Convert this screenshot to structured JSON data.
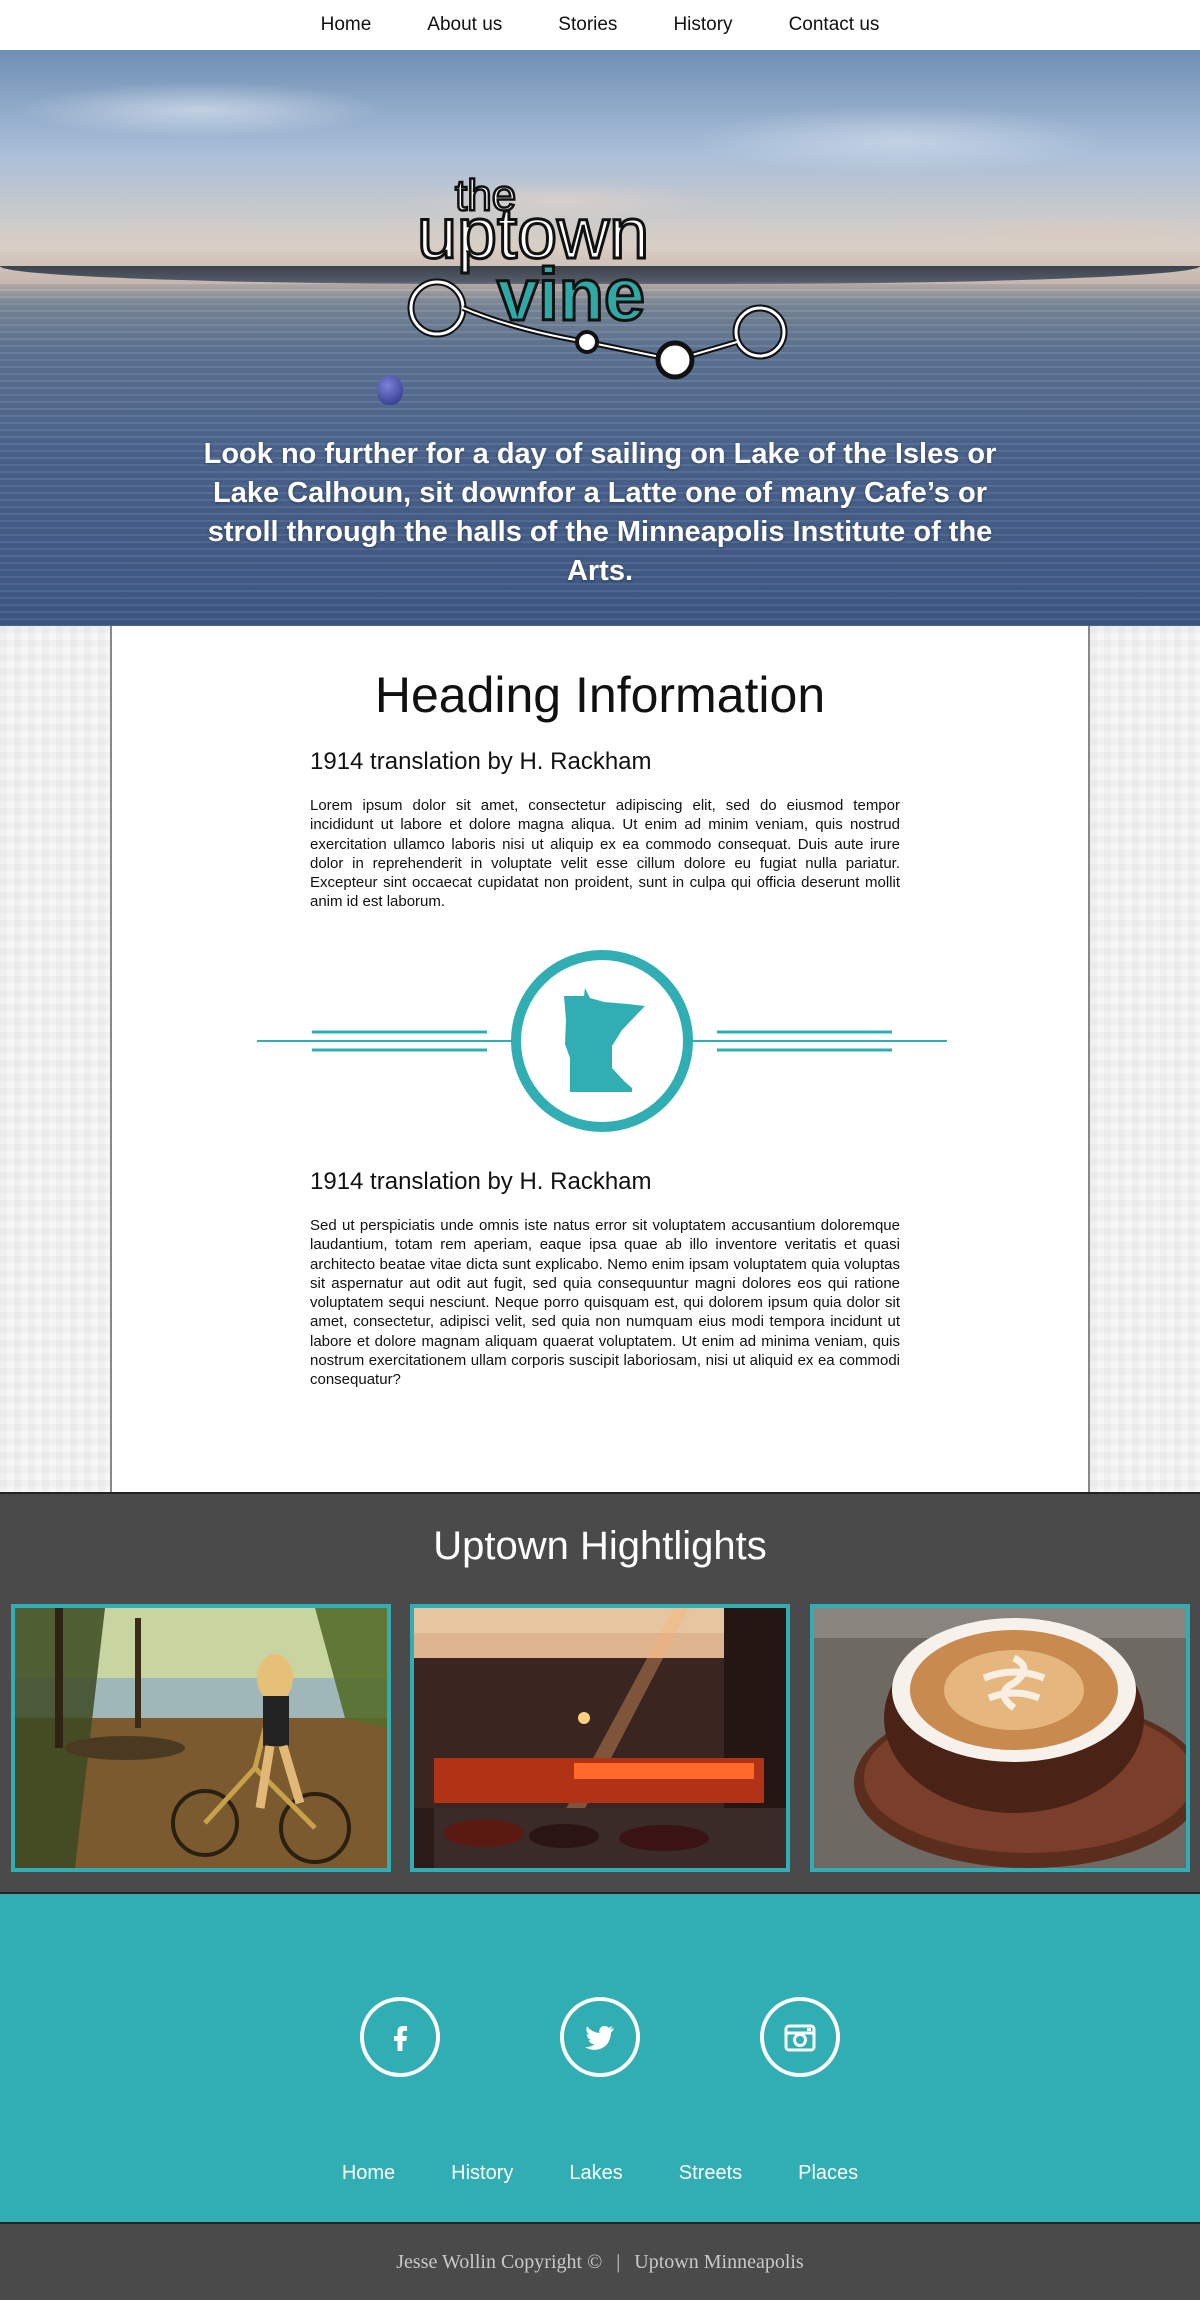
{
  "nav": {
    "items": [
      "Home",
      "About us",
      "Stories",
      "History",
      "Contact us"
    ]
  },
  "hero": {
    "logo": {
      "the": "the",
      "uptown": "uptown",
      "vine": "vine"
    },
    "tagline": "Look no further for a day of sailing on Lake of the Isles or Lake Calhoun, sit downfor a Latte one of many Cafe’s or stroll through the halls of the Minneapolis Institute of the Arts."
  },
  "main": {
    "heading": "Heading Information",
    "section1": {
      "title": "1914 translation by H. Rackham",
      "body": "Lorem ipsum dolor sit amet, consectetur adipiscing elit, sed do eiusmod tempor incididunt ut labore et dolore magna aliqua. Ut enim ad minim veniam, quis nostrud exercitation ullamco laboris nisi ut aliquip ex ea commodo consequat. Duis aute irure dolor in reprehenderit in voluptate velit esse cillum dolore eu fugiat nulla pariatur. Excepteur sint occaecat cupidatat non proident, sunt in culpa qui officia deserunt mollit anim id est laborum."
    },
    "emblem_icon": "minnesota-state-icon",
    "section2": {
      "title": "1914 translation by H. Rackham",
      "body": "Sed ut perspiciatis unde omnis iste natus error sit voluptatem accusantium doloremque laudantium, totam rem aperiam, eaque ipsa quae ab illo inventore veritatis et quasi architecto beatae vitae dicta sunt explicabo. Nemo enim ipsam voluptatem quia voluptas sit aspernatur aut odit aut fugit, sed quia consequuntur magni dolores eos qui ratione voluptatem sequi nesciunt. Neque porro quisquam est, qui dolorem ipsum quia dolor sit amet, consectetur, adipisci velit, sed quia non numquam eius modi tempora incidunt ut labore et dolore magnam aliquam quaerat voluptatem. Ut enim ad minima veniam, quis nostrum exercitationem ullam corporis suscipit laboriosam, nisi ut aliquid ex ea commodi consequatur?"
    }
  },
  "highlights": {
    "title": "Uptown Hightlights",
    "photos": [
      "lake-cyclist-photo",
      "uptown-street-night-photo",
      "latte-cup-photo"
    ]
  },
  "social": [
    "facebook-icon",
    "twitter-icon",
    "instagram-icon"
  ],
  "footer_nav": [
    "Home",
    "History",
    "Lakes",
    "Streets",
    "Places"
  ],
  "copyright": {
    "left": "Jesse Wollin Copyright ©",
    "sep": "|",
    "right": "Uptown Minneapolis"
  },
  "colors": {
    "teal": "#30aeb3",
    "dark": "#4a4a4a"
  }
}
